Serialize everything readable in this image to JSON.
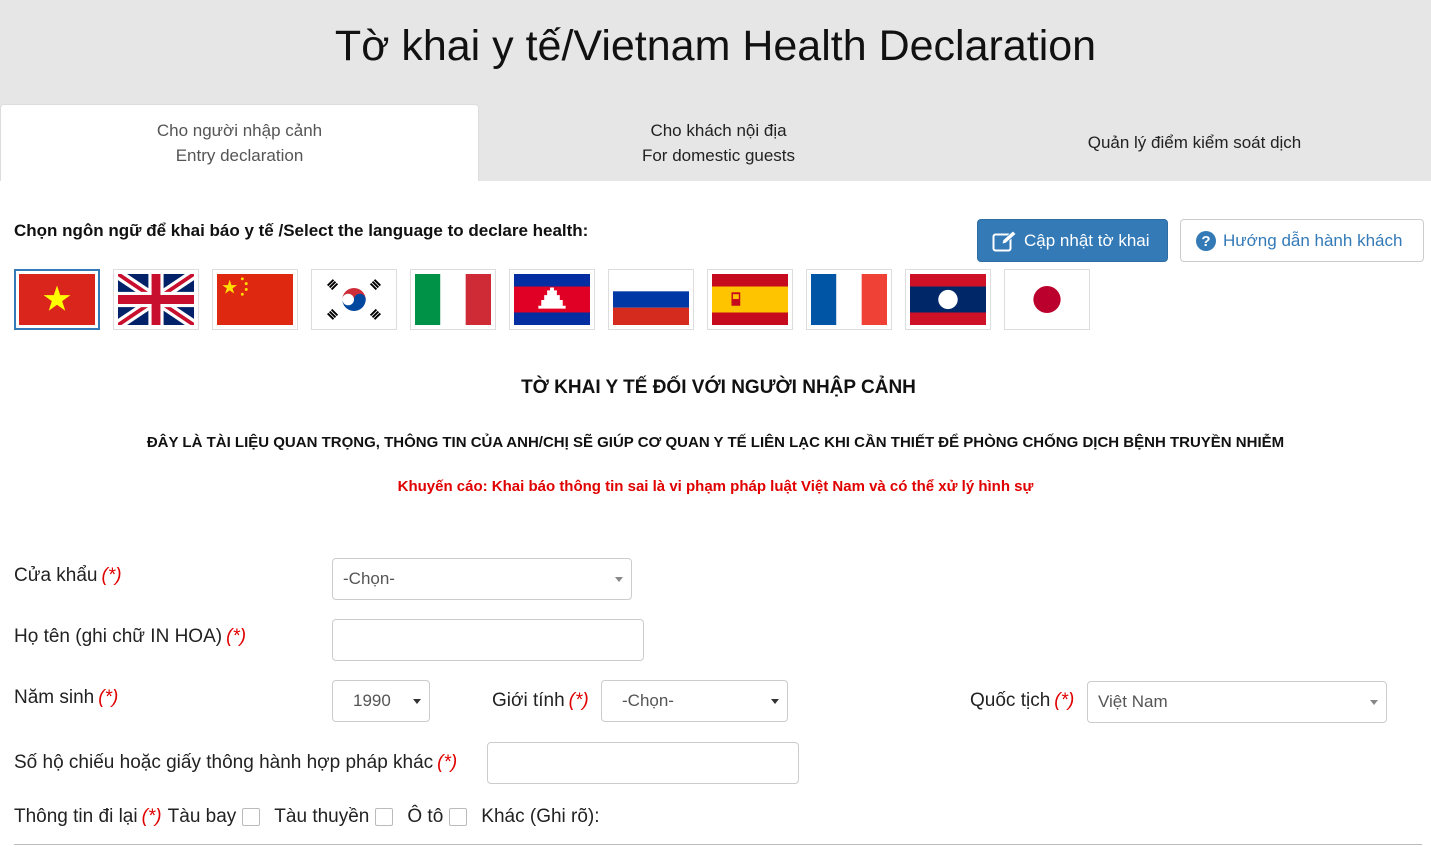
{
  "page": {
    "title": "Tờ khai y tế/Vietnam Health Declaration"
  },
  "tabs": [
    {
      "line1": "Cho người nhập cảnh",
      "line2": "Entry declaration",
      "active": true
    },
    {
      "line1": "Cho khách nội địa",
      "line2": "For domestic guests",
      "active": false
    },
    {
      "line1": "Quản lý điểm kiểm soát dịch",
      "line2": "",
      "active": false
    }
  ],
  "language": {
    "label": "Chọn ngôn ngữ để khai báo y tế /Select the language to declare health:",
    "flags": [
      "vietnam-flag-icon",
      "uk-flag-icon",
      "china-flag-icon",
      "korea-flag-icon",
      "italy-flag-icon",
      "cambodia-flag-icon",
      "russia-flag-icon",
      "spain-flag-icon",
      "france-flag-icon",
      "laos-flag-icon",
      "japan-flag-icon"
    ],
    "selected": "vietnam-flag-icon"
  },
  "buttons": {
    "update_label": "Cập nhật tờ khai",
    "guide_label": "Hướng dẫn hành khách"
  },
  "form": {
    "title": "TỜ KHAI Y TẾ ĐỐI VỚI NGƯỜI NHẬP CẢNH",
    "note": "ĐÂY LÀ TÀI LIỆU QUAN TRỌNG, THÔNG TIN CỦA ANH/CHỊ SẼ GIÚP CƠ QUAN Y TẾ LIÊN LẠC KHI CẦN THIẾT ĐỂ PHÒNG CHỐNG DỊCH BỆNH TRUYỀN NHIỄM",
    "warning": "Khuyến cáo: Khai báo thông tin sai là vi phạm pháp luật Việt Nam và có thể xử lý hình sự",
    "required_mark": "(*)",
    "border_gate": {
      "label": "Cửa khẩu",
      "value": "-Chọn-"
    },
    "full_name": {
      "label": "Họ tên (ghi chữ IN HOA)",
      "value": ""
    },
    "birth_year": {
      "label": "Năm sinh",
      "value": "1990"
    },
    "gender": {
      "label": "Giới tính",
      "value": "-Chọn-"
    },
    "nationality": {
      "label": "Quốc tịch",
      "value": "Việt Nam"
    },
    "passport": {
      "label": "Số hộ chiếu hoặc giấy thông hành hợp pháp khác",
      "value": ""
    },
    "travel": {
      "label": "Thông tin đi lại",
      "options": [
        "Tàu bay",
        "Tàu thuyền",
        "Ô tô",
        "Khác (Ghi rõ):"
      ]
    }
  },
  "colors": {
    "primary": "#337ab7",
    "required": "#e00000",
    "header_bg": "#e6e6e6"
  }
}
